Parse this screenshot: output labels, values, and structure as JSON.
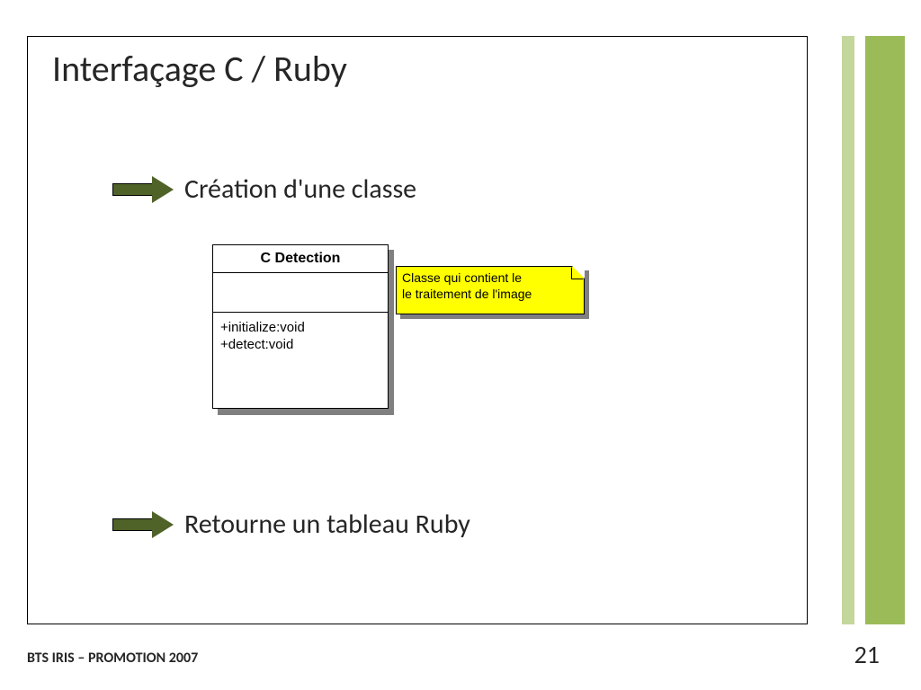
{
  "title": "Interfaçage C / Ruby",
  "bullets": {
    "creation": "Création d'une classe",
    "returns": "Retourne un tableau Ruby"
  },
  "uml": {
    "name": "C Detection",
    "ops": {
      "a": "+initialize:void",
      "b": "+detect:void"
    }
  },
  "note": {
    "line1": "Classe qui contient le",
    "line2": "le traitement de l'image"
  },
  "footer": {
    "left": "BTS IRIS – PROMOTION 2007",
    "page": "21"
  }
}
